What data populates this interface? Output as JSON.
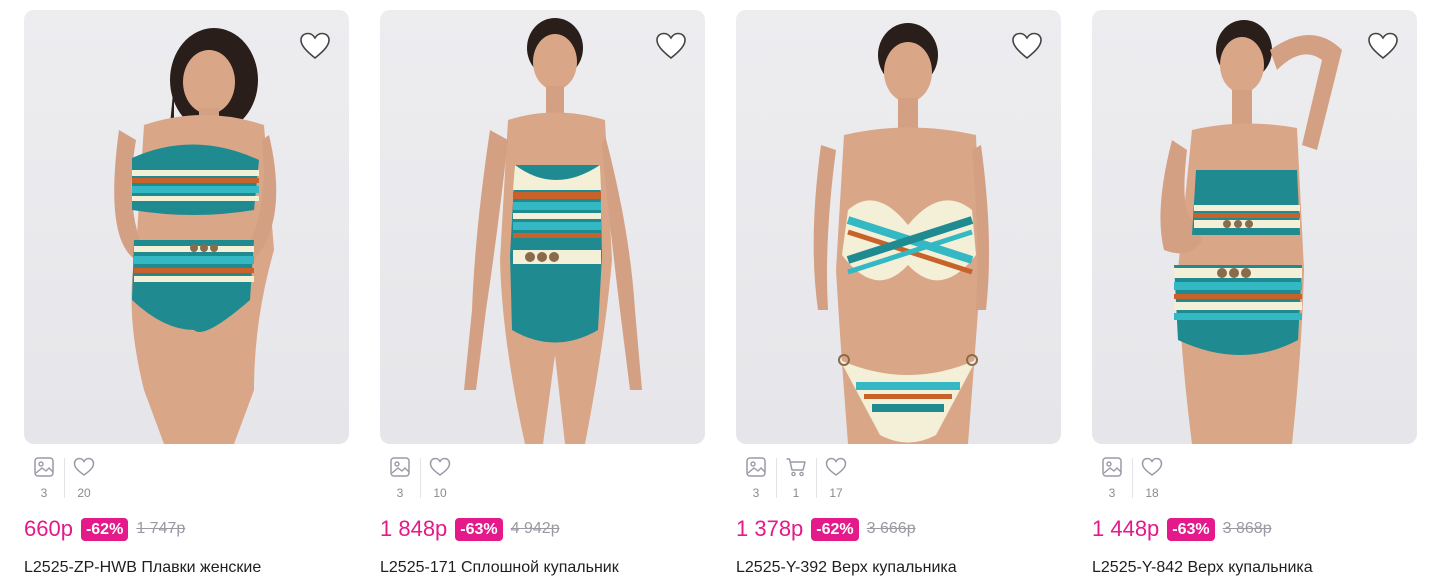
{
  "colors": {
    "accent": "#e4198a",
    "muted": "#9a9aa3",
    "swim_teal": "#1f8b91",
    "swim_cream": "#f4efd7",
    "swim_orange": "#c7632a",
    "swim_aqua": "#33b8c4"
  },
  "products": [
    {
      "photos_count": "3",
      "likes_count": "20",
      "price": "660р",
      "discount": "-62%",
      "old_price": "1 747р",
      "title": "L2525-ZP-HWB Плавки женские",
      "type": "bikini-fullfigure"
    },
    {
      "photos_count": "3",
      "likes_count": "10",
      "price": "1 848р",
      "discount": "-63%",
      "old_price": "4 942р",
      "title": "L2525-171 Сплошной купальник",
      "type": "one-piece"
    },
    {
      "photos_count": "3",
      "cart_count": "1",
      "likes_count": "17",
      "price": "1 378р",
      "discount": "-62%",
      "old_price": "3 666р",
      "title": "L2525-Y-392 Верх купальника",
      "type": "bikini-twist"
    },
    {
      "photos_count": "3",
      "likes_count": "18",
      "price": "1 448р",
      "discount": "-63%",
      "old_price": "3 868р",
      "title": "L2525-Y-842 Верх купальника",
      "type": "bikini-bandeau"
    }
  ]
}
